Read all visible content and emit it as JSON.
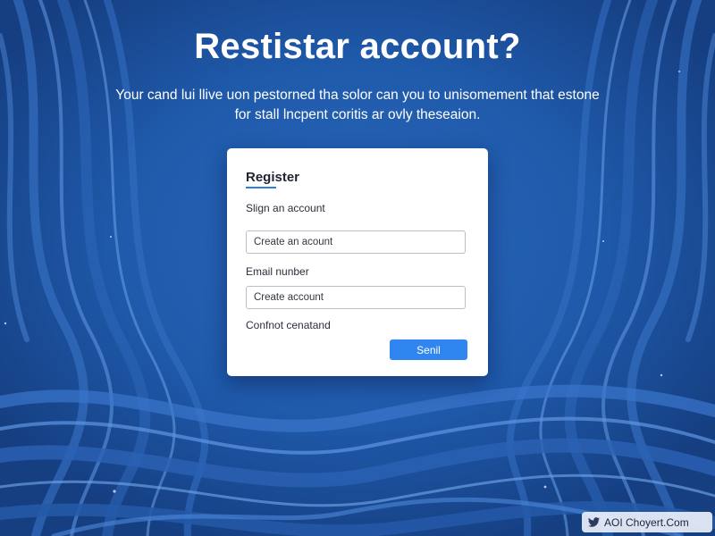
{
  "page": {
    "headline": "Restistar account?",
    "subtext_lines": [
      "Your cand lui llive uon pestorned tha solor can you to unisomement that estone",
      "for stall lncpent coritis ar ovly theseaion."
    ]
  },
  "form": {
    "title": "Register",
    "sign_label": "Slign an account",
    "field1_value": "Create an acount",
    "email_label": "Email nunber",
    "field2_value": "Create account",
    "confirm_label": "Confnot cenatand",
    "send_label": "Senil"
  },
  "watermark": {
    "icon": "bird-icon",
    "text": "AOI Choyert.Com"
  },
  "colors": {
    "background": "#1d4f9a",
    "accent": "#2f86f0",
    "card": "#ffffff"
  }
}
